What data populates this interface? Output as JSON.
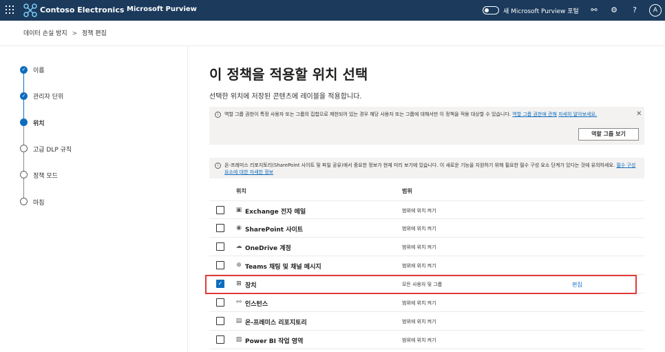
{
  "topbar": {
    "org_name": "Contoso Electronics",
    "app_name": "Microsoft Purview",
    "new_portal_label": "새 Microsoft Purview 포털",
    "avatar_initial": "A",
    "colors": {
      "bar": "#1b3a5c",
      "accent": "#0f6cbd",
      "highlight": "#e03a3a"
    }
  },
  "breadcrumb": {
    "item1": "데이터 손실 방지",
    "separator": ">",
    "item2": "정책 편집"
  },
  "steps": [
    {
      "label": "이름",
      "state": "done"
    },
    {
      "label": "관리자 단위",
      "state": "done"
    },
    {
      "label": "위치",
      "state": "current"
    },
    {
      "label": "고급 DLP 규칙",
      "state": "todo"
    },
    {
      "label": "정책 모드",
      "state": "todo"
    },
    {
      "label": "마침",
      "state": "todo"
    }
  ],
  "main": {
    "title": "이 정책을 적용할 위치 선택",
    "subtitle": "선택한 위치에 저장된 콘텐츠에 레이블을 적용합니다.",
    "notice1": {
      "text": "역할 그룹 권한이 특정 사용자 또는 그룹의 집합으로 제한되어 있는 경우 해당 사용자 또는 그룹에 대해서만 이 정책을 적용 대상할 수 있습니다.",
      "link1": "역할 그룹 권한에 관해",
      "link2": "자세히 알아보세요.",
      "button": "역할 그룹 보기"
    },
    "notice2": {
      "text": "온-프레미스 리포지토리(SharePoint 사이트 및 파일 공유)에서 중요한 정보가 현재 미리 보기에 있습니다. 이 새로운 기능을 지원하기 위해 필요한 필수 구성 요소 단계가 있다는 것에 유의하세요.",
      "link": "필수 구성 요소에 대한 자세한 정보"
    },
    "table": {
      "col_location": "위치",
      "col_scope": "범위",
      "rows": [
        {
          "name": "Exchange 전자 메일",
          "scope": "범위에 위치 켜기",
          "checked": false,
          "icon": "exchange-icon",
          "edit": ""
        },
        {
          "name": "SharePoint 사이트",
          "scope": "범위에 위치 켜기",
          "checked": false,
          "icon": "sharepoint-icon",
          "edit": ""
        },
        {
          "name": "OneDrive 계정",
          "scope": "범위에 위치 켜기",
          "checked": false,
          "icon": "cloud-icon",
          "edit": ""
        },
        {
          "name": "Teams 채팅 및 채널 메시지",
          "scope": "범위에 위치 켜기",
          "checked": false,
          "icon": "teams-icon",
          "edit": ""
        },
        {
          "name": "장치",
          "scope": "모든 사용자 및 그룹",
          "checked": true,
          "icon": "windows-icon",
          "edit": "편집"
        },
        {
          "name": "인스턴스",
          "scope": "범위에 위치 켜기",
          "checked": false,
          "icon": "instance-icon",
          "edit": ""
        },
        {
          "name": "온-프레미스 리포지토리",
          "scope": "범위에 위치 켜기",
          "checked": false,
          "icon": "repository-icon",
          "edit": ""
        },
        {
          "name": "Power BI 작업 영역",
          "scope": "범위에 위치 켜기",
          "checked": false,
          "icon": "powerbi-icon",
          "edit": ""
        }
      ]
    }
  }
}
